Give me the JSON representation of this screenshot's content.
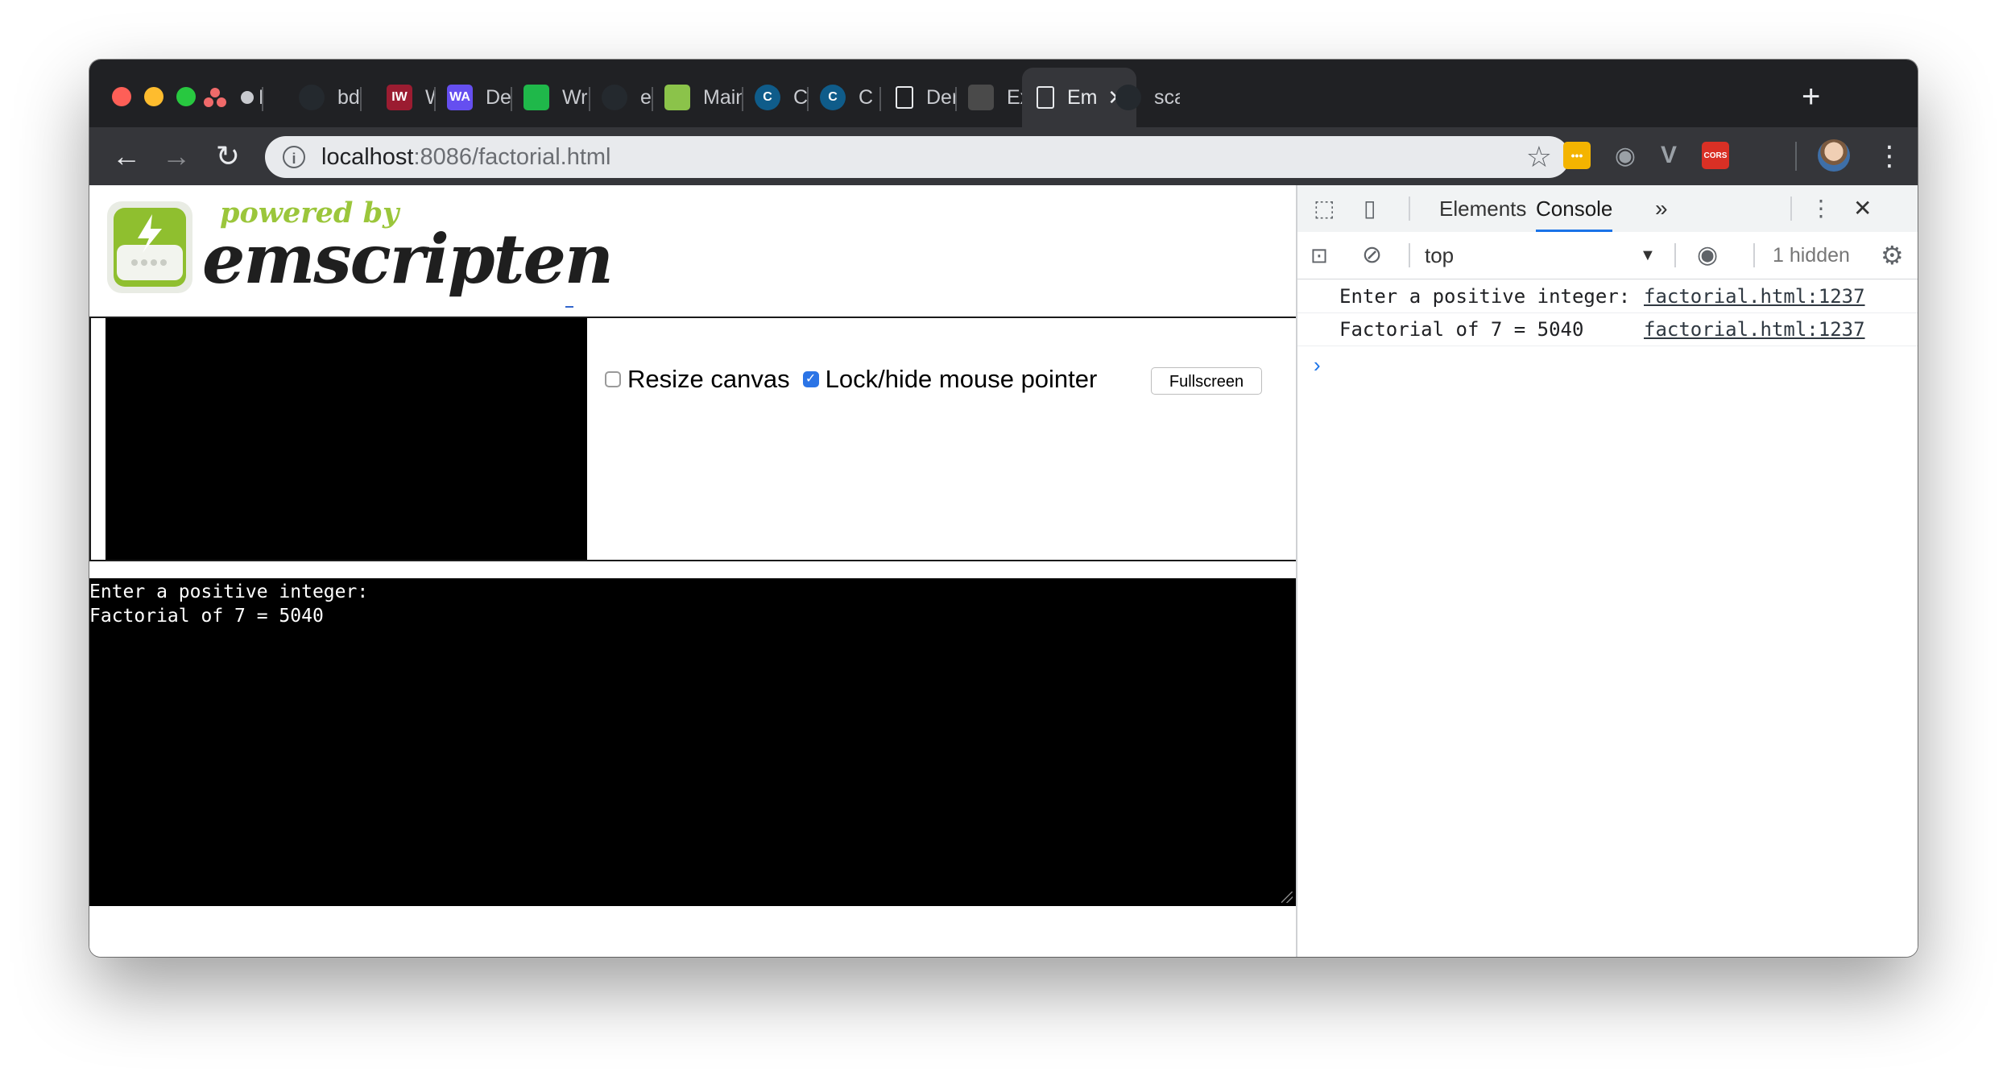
{
  "browser": {
    "tabs": [
      {
        "title": "Bra",
        "icon": "asana-icon",
        "color": "#f06a6a"
      },
      {
        "title": "bdwei",
        "icon": "github-icon",
        "color": "#24292e"
      },
      {
        "title": "What i",
        "icon": "iw-icon",
        "color": "#9b1c31"
      },
      {
        "title": "Develo",
        "icon": "webassembly-icon",
        "color": "#654ff0"
      },
      {
        "title": "Write",
        "icon": "clock-icon",
        "color": "#1fb84a"
      },
      {
        "title": "emscr",
        "icon": "github-icon",
        "color": "#24292e"
      },
      {
        "title": "Main -",
        "icon": "book-icon",
        "color": "#8bc34a"
      },
      {
        "title": "C Prog",
        "icon": "c-icon",
        "color": "#0f5c8a"
      },
      {
        "title": "C Prog",
        "icon": "c-icon",
        "color": "#0f5c8a"
      },
      {
        "title": "Demo",
        "icon": "document-icon",
        "color": "#e8eaed"
      },
      {
        "title": "Examp",
        "icon": "stack-icon",
        "color": "#4a4a4a"
      },
      {
        "title": "Em",
        "icon": "document-icon",
        "color": "#e8eaed",
        "active": true
      },
      {
        "title": "scanf",
        "icon": "github-icon",
        "color": "#24292e"
      }
    ],
    "fav_letters": [
      "",
      "",
      "IW",
      "WA",
      "",
      "",
      "",
      "C",
      "C",
      "",
      "",
      "",
      ""
    ],
    "new_tab": "+",
    "url_host": "localhost",
    "url_rest": ":8086/factorial.html",
    "extensions": [
      {
        "name": "sticky-notes-icon",
        "color": "#f4b400",
        "glyph": "•••"
      },
      {
        "name": "camera-icon",
        "color": "#9aa0a6",
        "glyph": "◉"
      },
      {
        "name": "vue-devtools-icon",
        "color": "#9aa0a6",
        "glyph": "V"
      },
      {
        "name": "cors-icon",
        "color": "#d93025",
        "glyph": "CORS"
      }
    ]
  },
  "page": {
    "logo_tag": "powered by",
    "logo_word": "emscripten",
    "resize_label": "Resize canvas",
    "resize_checked": false,
    "lock_label": "Lock/hide mouse pointer",
    "lock_checked": true,
    "fullscreen_label": "Fullscreen",
    "output_lines": "Enter a positive integer:\nFactorial of 7 = 5040"
  },
  "devtools": {
    "tabs": [
      "Elements",
      "Console"
    ],
    "active_tab": "Console",
    "more": "»",
    "context": "top",
    "hidden_count": "1 hidden",
    "logs": [
      {
        "message": "Enter a positive integer:",
        "source": "factorial.html:1237"
      },
      {
        "message": "Factorial of 7 = 5040",
        "source": "factorial.html:1237"
      }
    ],
    "prompt": "›"
  }
}
